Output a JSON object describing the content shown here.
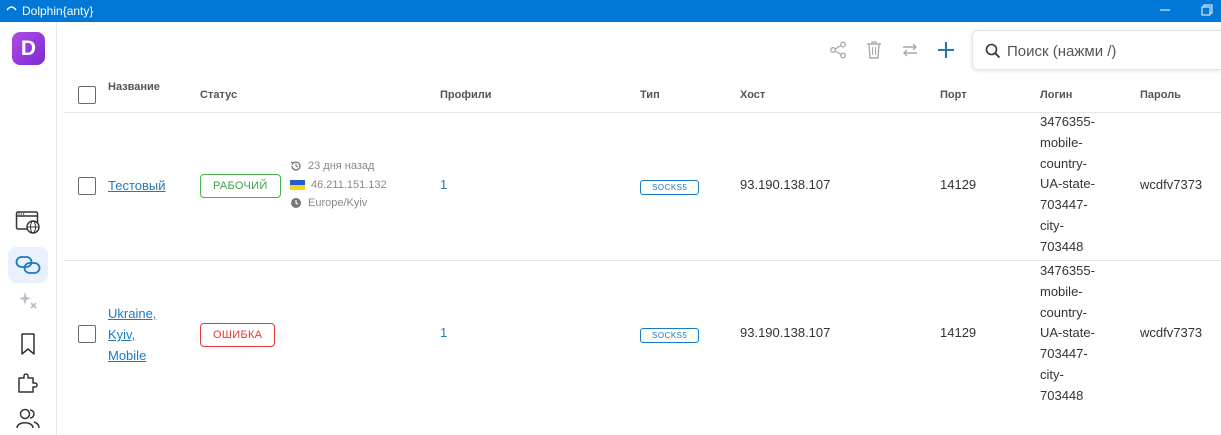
{
  "window": {
    "title": "Dolphin{anty}"
  },
  "colors": {
    "accent": "#1a7ac4",
    "titlebar": "#0078d7",
    "logo": "#9b3fe0",
    "ok": "#43a047",
    "error": "#e53935"
  },
  "sidebar": {
    "logo_letter": "D",
    "items": [
      {
        "icon": "browser-globe-icon"
      },
      {
        "icon": "proxy-link-icon",
        "active": true
      },
      {
        "icon": "sparkle-icon"
      },
      {
        "icon": "bookmark-icon"
      },
      {
        "icon": "puzzle-icon"
      },
      {
        "icon": "users-icon"
      }
    ]
  },
  "toolbar": {
    "icons": [
      "share-icon",
      "trash-icon",
      "swap-icon",
      "plus-icon"
    ]
  },
  "search": {
    "placeholder": "Поиск (нажми /)"
  },
  "table": {
    "headers": {
      "name": "Название",
      "status": "Статус",
      "profiles": "Профили",
      "type": "Тип",
      "host": "Хост",
      "port": "Порт",
      "login": "Логин",
      "password": "Пароль"
    },
    "rows": [
      {
        "name_lines": [
          "Тестовый"
        ],
        "status": "РАБОЧИЙ",
        "status_kind": "ok",
        "last_check": "23 дня назад",
        "ip": "46.211.151.132",
        "timezone": "Europe/Kyiv",
        "profiles": "1",
        "type": "SOCKS5",
        "host": "93.190.138.107",
        "port": "14129",
        "login_lines": [
          "3476355-",
          "mobile-",
          "country-",
          "UA-state-",
          "703447-",
          "city-",
          "703448"
        ],
        "password": "wcdfv7373"
      },
      {
        "name_lines": [
          "Ukraine,",
          "Kyiv,",
          "Mobile"
        ],
        "status": "ОШИБКА",
        "status_kind": "err",
        "profiles": "1",
        "type": "SOCKS5",
        "host": "93.190.138.107",
        "port": "14129",
        "login_lines": [
          "3476355-",
          "mobile-",
          "country-",
          "UA-state-",
          "703447-",
          "city-",
          "703448"
        ],
        "password": "wcdfv7373"
      }
    ]
  }
}
